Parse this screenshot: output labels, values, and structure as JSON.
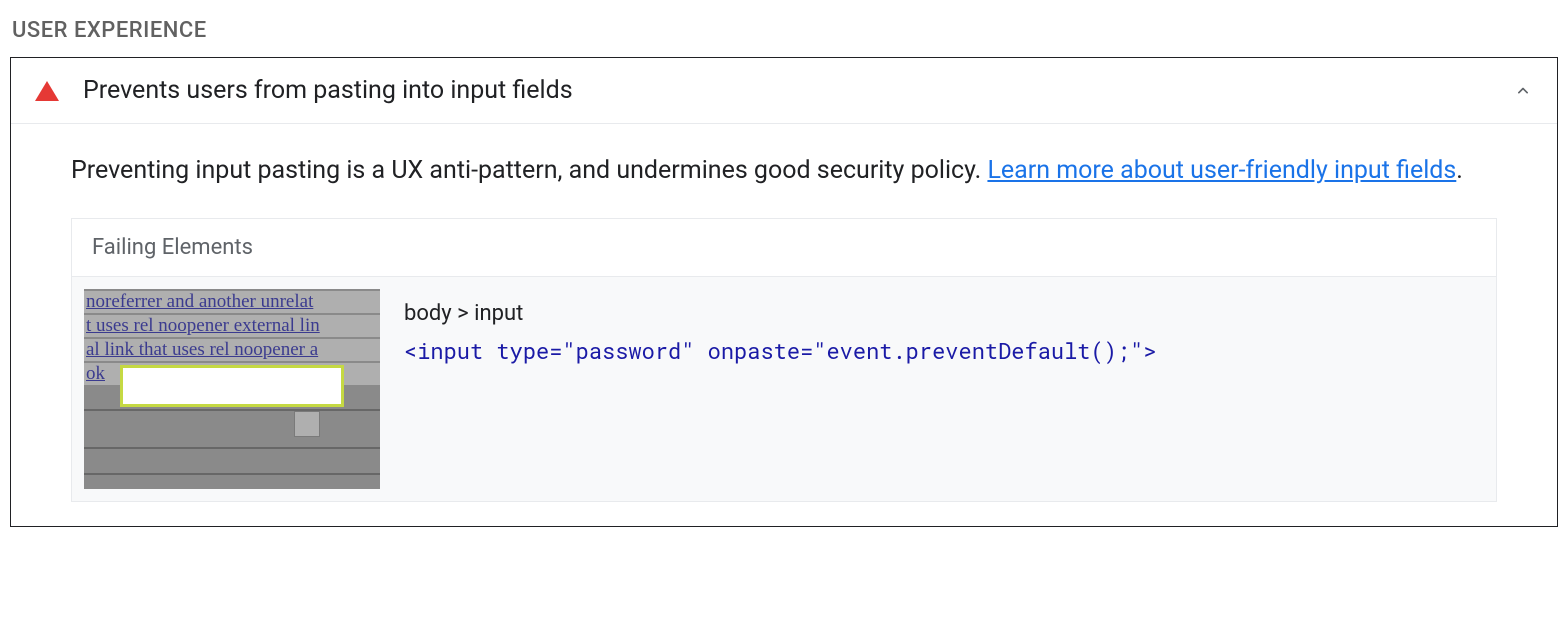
{
  "section": {
    "title": "USER EXPERIENCE"
  },
  "audit": {
    "title": "Prevents users from pasting into input fields",
    "descriptionPrefix": "Preventing input pasting is a UX anti-pattern, and undermines good security policy. ",
    "learnMoreText": "Learn more about user-friendly input fields",
    "descriptionSuffix": ".",
    "status": "fail",
    "statusColor": "#e53935"
  },
  "failingElements": {
    "header": "Failing Elements",
    "items": [
      {
        "selector": "body > input",
        "snippet": "<input type=\"password\" onpaste=\"event.preventDefault();\">",
        "thumbnail": {
          "line1": "  noreferrer and another unrelat",
          "line2": "t uses rel noopener external lin",
          "line3": "al link that uses rel noopener a",
          "line4": "  ok"
        }
      }
    ]
  }
}
